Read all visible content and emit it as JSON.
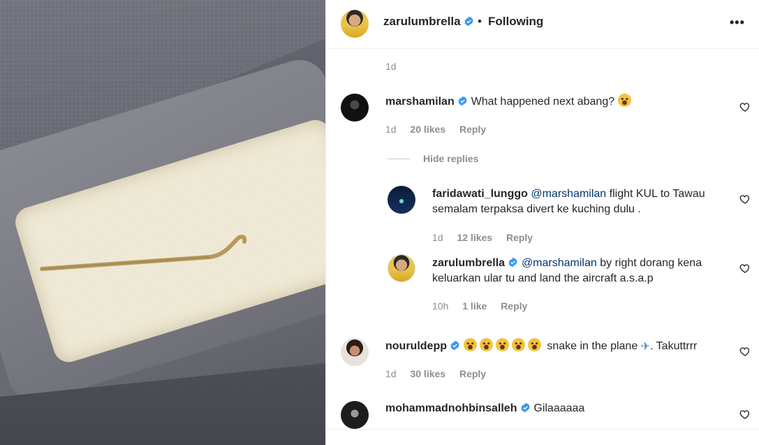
{
  "header": {
    "username": "zarulumbrella",
    "separator": "•",
    "follow_status": "Following",
    "more_label": "•••"
  },
  "caption": {
    "time": "1d"
  },
  "comments": [
    {
      "username": "marshamilan",
      "text": "What happened next abang?",
      "time": "1d",
      "likes": "20 likes",
      "reply": "Reply"
    },
    {
      "username": "nouruldepp",
      "text_before": "snake in the plane",
      "text_after": ". Takuttrrr",
      "time": "1d",
      "likes": "30 likes",
      "reply": "Reply"
    },
    {
      "username": "mohammadnohbinsalleh",
      "text": "Gilaaaaaa"
    }
  ],
  "replies_toggle": "Hide replies",
  "replies": [
    {
      "username": "faridawati_lunggo",
      "mention": "@marshamilan",
      "text_line1": "flight KUL to Tawau",
      "text_line2": "semalam terpaksa divert ke kuching dulu .",
      "time": "1d",
      "likes": "12 likes",
      "reply": "Reply"
    },
    {
      "username": "zarulumbrella",
      "mention": "@marshamilan",
      "text_line1": "by right dorang kena",
      "text_line2": "keluarkan ular tu and land the aircraft a.s.a.p",
      "time": "10h",
      "likes": "1 like",
      "reply": "Reply"
    }
  ],
  "colors": {
    "verified": "#3897f0",
    "mention": "#00376b",
    "meta": "#8e8e8e"
  }
}
